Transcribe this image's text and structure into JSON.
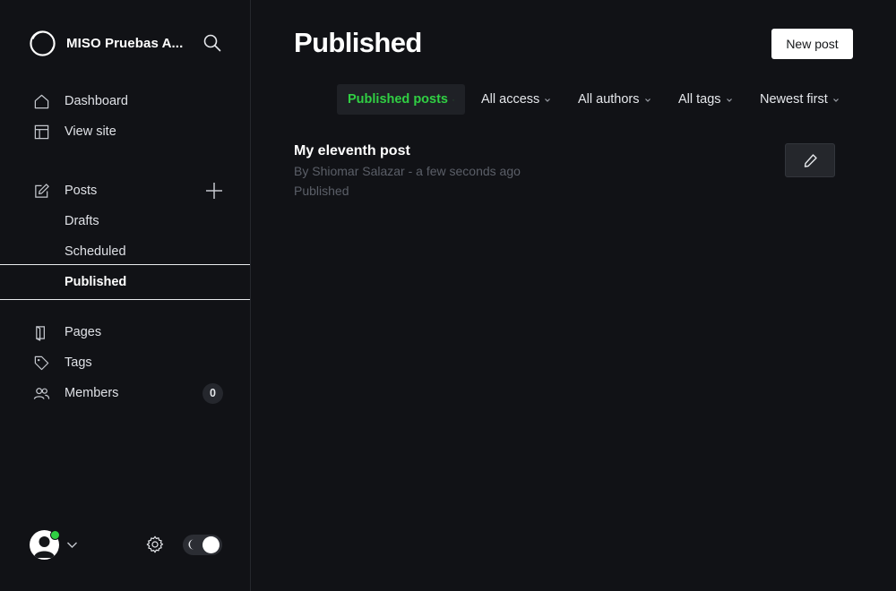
{
  "brand": {
    "name": "MISO Pruebas A..."
  },
  "sidebar": {
    "items": [
      {
        "label": "Dashboard",
        "icon": "home-icon"
      },
      {
        "label": "View site",
        "icon": "layout-icon"
      },
      {
        "label": "Posts",
        "icon": "edit-icon"
      },
      {
        "label": "Drafts"
      },
      {
        "label": "Scheduled"
      },
      {
        "label": "Published"
      },
      {
        "label": "Pages",
        "icon": "pages-icon"
      },
      {
        "label": "Tags",
        "icon": "tag-icon"
      },
      {
        "label": "Members",
        "icon": "members-icon"
      }
    ],
    "members_count": "0",
    "active_item": "Published"
  },
  "header": {
    "title": "Published",
    "new_post_label": "New post"
  },
  "filters": [
    {
      "label": "Published posts",
      "selected": true
    },
    {
      "label": "All access"
    },
    {
      "label": "All authors"
    },
    {
      "label": "All tags"
    },
    {
      "label": "Newest first"
    }
  ],
  "posts": [
    {
      "title": "My eleventh post",
      "meta": "By Shiomar Salazar - a few seconds ago",
      "status": "Published"
    }
  ],
  "colors": {
    "background": "#111216",
    "accent_green": "#30cf43",
    "text_muted": "#5b5f68"
  }
}
